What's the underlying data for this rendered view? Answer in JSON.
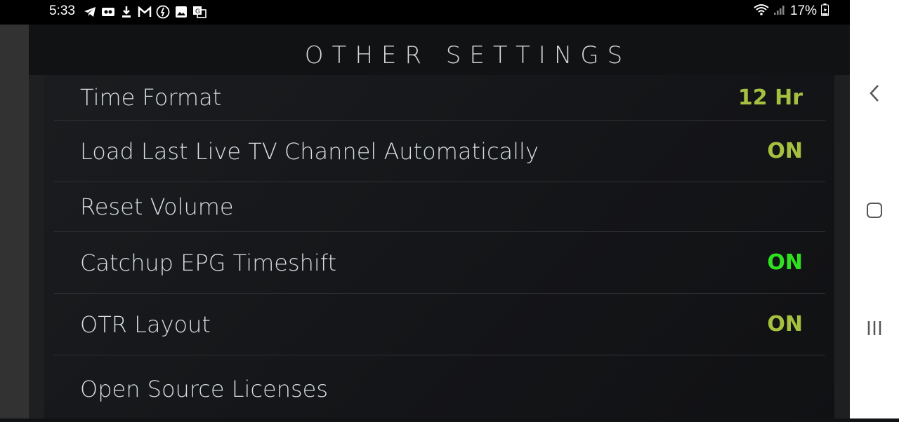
{
  "status_bar": {
    "time": "5:33",
    "battery": "17%",
    "icons": [
      "telegram-icon",
      "voicemail-icon",
      "download-icon",
      "gmail-icon",
      "messenger-icon",
      "gallery-icon",
      "translate-icon"
    ]
  },
  "header": {
    "title": "OTHER SETTINGS"
  },
  "settings": [
    {
      "label": "Time Format",
      "value": "12 Hr",
      "value_color": "#a6c140"
    },
    {
      "label": "Load Last Live TV Channel Automatically",
      "value": "ON",
      "value_color": "#a6c140"
    },
    {
      "label": "Reset Volume",
      "value": ""
    },
    {
      "label": "Catchup EPG Timeshift",
      "value": "ON",
      "value_color": "#2fe21f"
    },
    {
      "label": "OTR Layout",
      "value": "ON",
      "value_color": "#a6c140"
    },
    {
      "label": "Open Source Licenses",
      "value": ""
    }
  ],
  "navbar": {
    "buttons": [
      "back-icon",
      "home-icon",
      "recents-icon"
    ]
  }
}
